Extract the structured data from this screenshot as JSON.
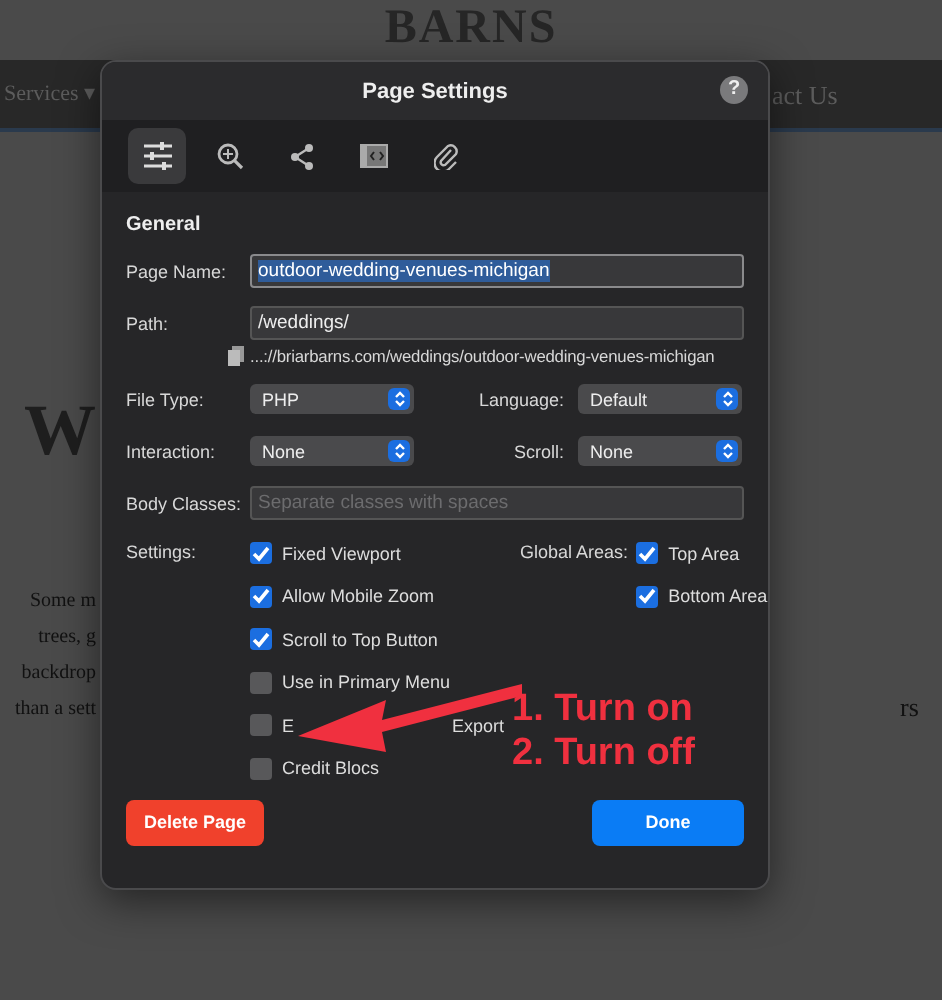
{
  "background_page": {
    "logo_text": "BARNS",
    "nav_items": [
      "Services ▾",
      "act Us"
    ],
    "heading": "W",
    "paragraph_lines": [
      "Some m",
      "trees, g",
      "backdrop",
      "than a sett"
    ],
    "side_text": "rs"
  },
  "dialog": {
    "title": "Page Settings",
    "help": "?",
    "tabs": [
      {
        "kind": "sliders",
        "selected": true
      },
      {
        "kind": "seo",
        "selected": false
      },
      {
        "kind": "share",
        "selected": false
      },
      {
        "kind": "code",
        "selected": false
      },
      {
        "kind": "attach",
        "selected": false
      }
    ],
    "section": "General",
    "page_name": {
      "label": "Page Name:",
      "value": "outdoor-wedding-venues-michigan"
    },
    "path": {
      "label": "Path:",
      "value": "/weddings/",
      "url": "...://briarbarns.com/weddings/outdoor-wedding-venues-michigan"
    },
    "file_type": {
      "label": "File Type:",
      "value": "PHP"
    },
    "language": {
      "label": "Language:",
      "value": "Default"
    },
    "interaction": {
      "label": "Interaction:",
      "value": "None"
    },
    "scroll": {
      "label": "Scroll:",
      "value": "None"
    },
    "body_classes": {
      "label": "Body Classes:",
      "placeholder": "Separate classes with spaces"
    },
    "settings_label": "Settings:",
    "settings": [
      {
        "label": [
          "Fixed Viewport"
        ],
        "checked": true
      },
      {
        "label": [
          "Allow Mobile Zoom"
        ],
        "checked": true
      },
      {
        "label": [
          "Scroll to Top Button"
        ],
        "checked": true
      },
      {
        "label": [
          "Use in Primary Menu"
        ],
        "checked": false
      },
      {
        "label": [
          "E",
          "Export"
        ],
        "checked": false
      },
      {
        "label": [
          "Credit Blocs"
        ],
        "checked": false
      }
    ],
    "global_areas_label": "Global Areas:",
    "global_areas": [
      {
        "label": "Top Area",
        "checked": true
      },
      {
        "label": "Bottom Area",
        "checked": true
      }
    ],
    "delete_button": "Delete Page",
    "done_button": "Done"
  },
  "annotation": {
    "lines": [
      "1. Turn on",
      "2. Turn off"
    ]
  }
}
